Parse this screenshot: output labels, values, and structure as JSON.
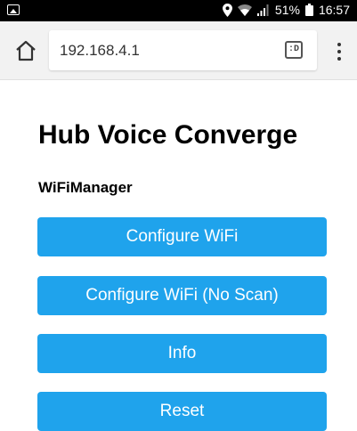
{
  "status_bar": {
    "battery": "51%",
    "time": "16:57",
    "icons": [
      "gallery-icon",
      "location-icon",
      "wifi-icon",
      "signal-icon",
      "battery-icon"
    ]
  },
  "browser": {
    "url": "192.168.4.1",
    "tabs_label": ":D",
    "icons": [
      "home-icon",
      "tabs-icon",
      "overflow-menu-icon"
    ]
  },
  "page": {
    "title": "Hub Voice Converge",
    "subtitle": "WiFiManager",
    "buttons": [
      "Configure WiFi",
      "Configure WiFi (No Scan)",
      "Info",
      "Reset"
    ]
  },
  "colors": {
    "button_bg": "#1fa3ec",
    "button_text": "#ffffff",
    "address_bar_bg": "#f2f2f2"
  }
}
